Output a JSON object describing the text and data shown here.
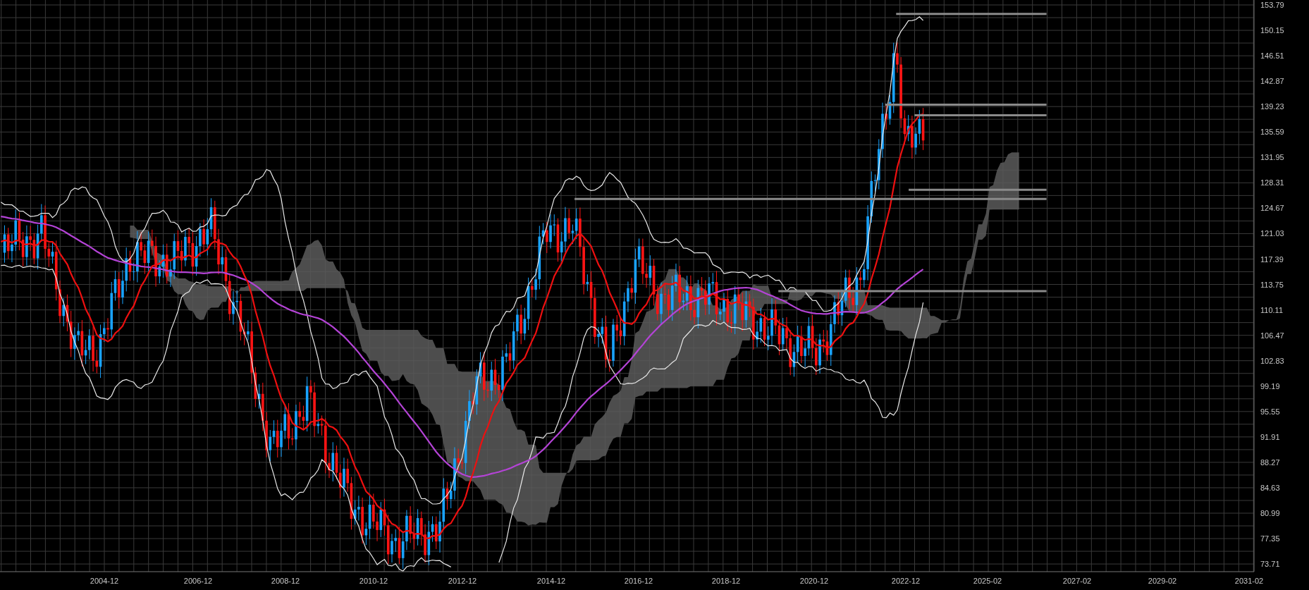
{
  "chart": {
    "y_axis_labels": [
      "153.79",
      "150.15",
      "146.51",
      "142.87",
      "139.23",
      "135.59",
      "131.95",
      "128.31",
      "124.67",
      "121.03",
      "117.39",
      "113.75",
      "110.11",
      "106.47",
      "102.83",
      "99.19",
      "95.55",
      "91.91",
      "88.27",
      "84.63",
      "80.99",
      "77.35",
      "73.71"
    ],
    "x_axis_labels": [
      "2004-12",
      "2006-12",
      "2008-12",
      "2010-12",
      "2012-12",
      "2014-12",
      "2016-12",
      "2018-12",
      "2020-12",
      "2022-12",
      "2025-02",
      "2027-02",
      "2029-02",
      "2031-02"
    ]
  }
}
